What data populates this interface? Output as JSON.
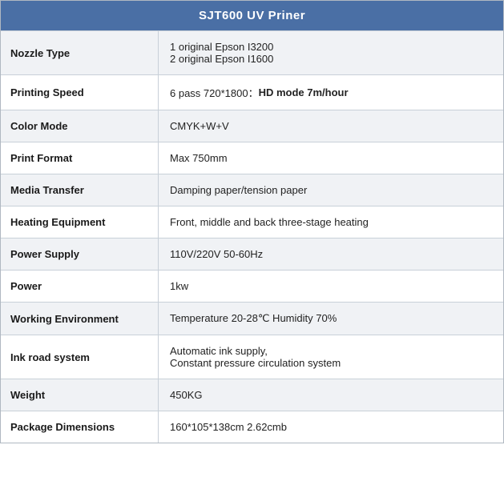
{
  "header": {
    "title": "SJT600 UV Priner"
  },
  "rows": [
    {
      "label": "Nozzle Type",
      "value": "1 original Epson I3200\n2 original Epson I1600",
      "multiline": true
    },
    {
      "label": "Printing Speed",
      "value_parts": [
        {
          "text": "6 pass 720*1800：",
          "bold": false
        },
        {
          "text": "HD mode 7m/hour",
          "bold": true
        }
      ]
    },
    {
      "label": "Color Mode",
      "value": "CMYK+W+V"
    },
    {
      "label": "Print Format",
      "value": "Max 750mm"
    },
    {
      "label": "Media Transfer",
      "value": "Damping paper/tension paper"
    },
    {
      "label": "Heating Equipment",
      "value": "Front, middle and back three-stage heating"
    },
    {
      "label": "Power Supply",
      "value": "110V/220V 50-60Hz"
    },
    {
      "label": "Power",
      "value": "1kw"
    },
    {
      "label": "Working Environment",
      "value": "Temperature 20-28℃  Humidity 70%"
    },
    {
      "label": "Ink road system",
      "value": "Automatic ink supply,\nConstant pressure circulation system",
      "multiline": true
    },
    {
      "label": "Weight",
      "value": "450KG"
    },
    {
      "label": "Package Dimensions",
      "value": "160*105*138cm 2.62cmb"
    }
  ]
}
